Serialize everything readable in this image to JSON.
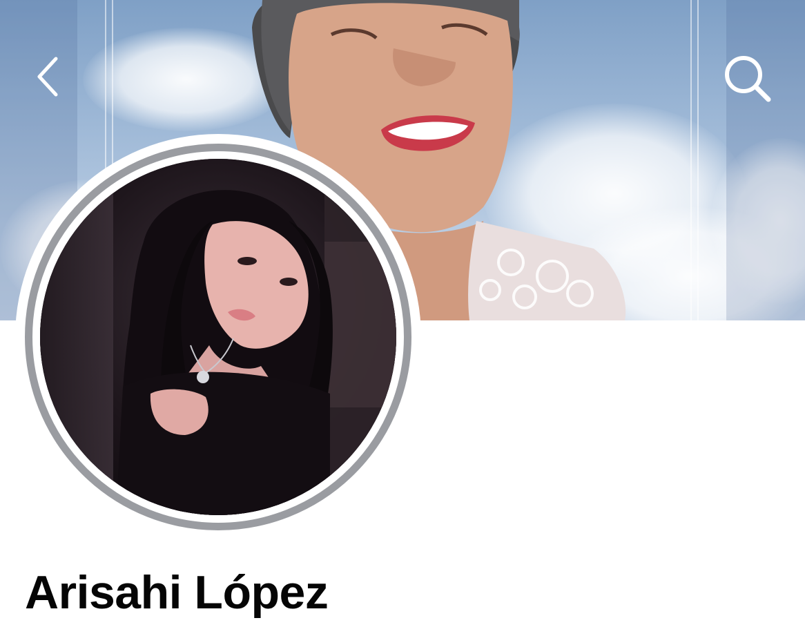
{
  "profile": {
    "name": "Arisahi López"
  },
  "navigation": {
    "back_icon": "chevron-left-icon",
    "search_icon": "search-icon"
  },
  "colors": {
    "name_text": "#050505",
    "avatar_ring": "#9a9ca1",
    "nav_icon": "#ffffff",
    "background": "#ffffff"
  }
}
